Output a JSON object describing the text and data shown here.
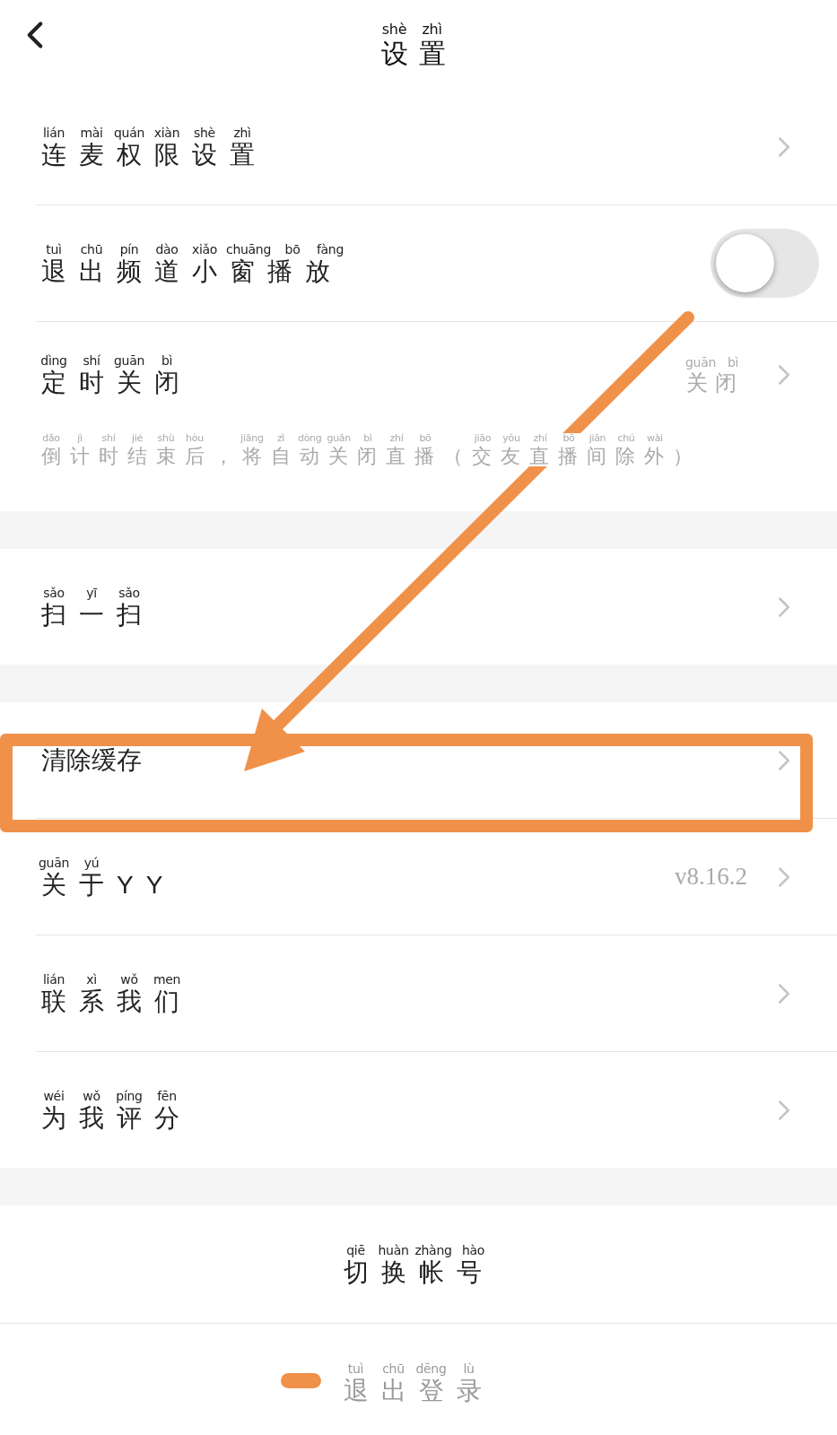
{
  "header": {
    "title": "设置",
    "pinyin": "shè zhì"
  },
  "sections": [
    {
      "items": [
        {
          "kind": "link",
          "label": "连麦权限设置",
          "pinyin": "lián mài quán xiàn shè zhì",
          "highlighted": false
        },
        {
          "kind": "toggle",
          "label": "退出频道小窗播放",
          "pinyin": "tuì chū pín dào xiǎo chuāng bō fàng",
          "on": false,
          "highlighted": false
        },
        {
          "kind": "link",
          "label": "定时关闭",
          "pinyin": "dìng shí guān bì",
          "value": "关闭",
          "value_pinyin": "guān bì",
          "description": "倒计时结束后，将自动关闭直播（交友直播间除外）",
          "description_pinyin": "dǎo jì shí jié shù hòu jiāng zì dòng guān bì zhí bō jiāo yǒu zhí bō jiān chú wài",
          "highlighted": false
        }
      ]
    },
    {
      "items": [
        {
          "kind": "link",
          "label": "扫一扫",
          "pinyin": "sǎo yī sǎo",
          "highlighted": false
        }
      ]
    },
    {
      "items": [
        {
          "kind": "link",
          "label": "清除缓存",
          "highlighted": true
        },
        {
          "kind": "link",
          "label": "关于YY",
          "pinyin": "guān yú",
          "value": "v8.16.2",
          "highlighted": false
        },
        {
          "kind": "link",
          "label": "联系我们",
          "pinyin": "lián xì wǒ men",
          "highlighted": false
        },
        {
          "kind": "link",
          "label": "为我评分",
          "pinyin": "wéi wǒ píng fēn",
          "highlighted": false
        }
      ]
    },
    {
      "items": [
        {
          "kind": "action",
          "label": "切换帐号",
          "pinyin": "qiē huàn zhàng hào",
          "dimmed": false,
          "marked": false
        },
        {
          "kind": "action",
          "label": "退出登录",
          "pinyin": "tuì chū dēng lù",
          "dimmed": true,
          "marked": true
        }
      ]
    }
  ]
}
